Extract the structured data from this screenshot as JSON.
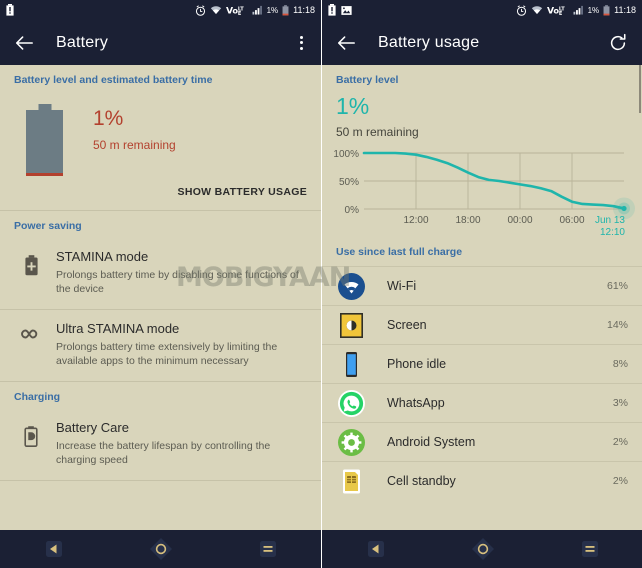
{
  "left": {
    "statusbar": {
      "left_icons": [
        "battery-alert-icon"
      ],
      "alarm_icon": "alarm-icon",
      "wifi_icon": "wifi-icon",
      "volte_icon": "volte-icon",
      "signal_icon": "signal-icon",
      "battery_percent": "1%",
      "battery_icon": "battery-icon",
      "clock": "11:18"
    },
    "appbar": {
      "title": "Battery",
      "back_icon": "back-arrow-icon",
      "overflow_icon": "overflow-menu-icon"
    },
    "section_battery_level": "Battery level and estimated battery time",
    "battery": {
      "percent": "1%",
      "remaining": "50 m remaining",
      "show_usage": "SHOW BATTERY USAGE"
    },
    "section_power_saving": "Power saving",
    "section_charging": "Charging",
    "rows": [
      {
        "icon": "battery-plus-icon",
        "title": "STAMINA mode",
        "subtitle": "Prolongs battery time by disabling some functions of the device"
      },
      {
        "icon": "infinity-icon",
        "title": "Ultra STAMINA mode",
        "subtitle": "Prolongs battery time extensively by limiting the available apps to the minimum necessary"
      },
      {
        "icon": "battery-care-icon",
        "title": "Battery Care",
        "subtitle": "Increase the battery lifespan by controlling the charging speed"
      }
    ]
  },
  "right": {
    "statusbar": {
      "left_icons": [
        "battery-alert-icon",
        "screenshot-icon"
      ],
      "alarm_icon": "alarm-icon",
      "wifi_icon": "wifi-icon",
      "volte_icon": "volte-icon",
      "signal_icon": "signal-icon",
      "battery_percent": "1%",
      "battery_icon": "battery-icon",
      "clock": "11:18"
    },
    "appbar": {
      "title": "Battery usage",
      "back_icon": "back-arrow-icon",
      "refresh_icon": "refresh-icon"
    },
    "section_battery_level": "Battery level",
    "battery": {
      "percent": "1%",
      "remaining": "50 m remaining"
    },
    "use_since": "Use since last full charge",
    "apps": [
      {
        "icon": "wifi-app-icon",
        "name": "Wi-Fi",
        "percent": "61%",
        "color": "#1b4f8f"
      },
      {
        "icon": "screen-app-icon",
        "name": "Screen",
        "percent": "14%",
        "color": "#f0c53a"
      },
      {
        "icon": "phone-idle-icon",
        "name": "Phone idle",
        "percent": "8%",
        "color": "#3f9ff0"
      },
      {
        "icon": "whatsapp-icon",
        "name": "WhatsApp",
        "percent": "3%",
        "color": "#25d366"
      },
      {
        "icon": "android-system-icon",
        "name": "Android System",
        "percent": "2%",
        "color": "#6bbd45"
      },
      {
        "icon": "cell-standby-icon",
        "name": "Cell standby",
        "percent": "2%",
        "color": "#e8c84a"
      }
    ]
  },
  "chart_data": {
    "type": "line",
    "title": "Battery level",
    "xlabel": "",
    "ylabel": "",
    "ylim": [
      0,
      100
    ],
    "ytick_labels": [
      "100%",
      "50%",
      "0%"
    ],
    "ytick_values": [
      100,
      50,
      0
    ],
    "xtick_labels": [
      "12:00",
      "18:00",
      "00:00",
      "06:00"
    ],
    "end_label": {
      "date": "Jun 13",
      "time": "12:10"
    },
    "grid": true,
    "legend": "none",
    "line_color": "#1fb5ab",
    "series": [
      {
        "name": "Battery level",
        "x": [
          0,
          4,
          8,
          12,
          16,
          20,
          24,
          28,
          32,
          36,
          40,
          44,
          48,
          52,
          56,
          60,
          64,
          68,
          72,
          76,
          80,
          84,
          88,
          92,
          96,
          100
        ],
        "values": [
          100,
          100,
          100,
          100,
          99,
          97,
          93,
          88,
          82,
          74,
          65,
          57,
          52,
          50,
          47,
          44,
          41,
          37,
          32,
          22,
          13,
          9,
          8,
          7,
          5,
          1
        ]
      }
    ]
  },
  "watermark": "MOBIGYAAN",
  "navbar": {
    "back_icon": "nav-back-icon",
    "home_icon": "nav-home-icon",
    "recents_icon": "nav-recents-icon"
  },
  "colors": {
    "accent_teal": "#1fb5ab",
    "accent_red": "#b3412e",
    "section_blue": "#3a6ea5",
    "bg": "#d9d5bb",
    "bar": "#1b2034"
  }
}
